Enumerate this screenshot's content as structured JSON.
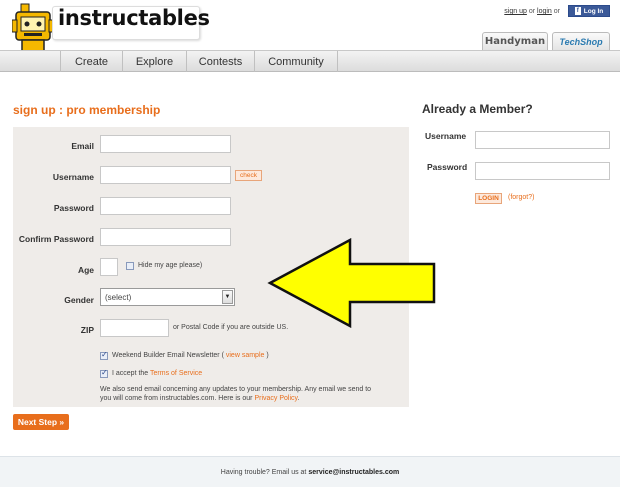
{
  "header": {
    "logo_text": "instructables",
    "signup_link": "sign up",
    "or_1": "or",
    "login_link": "login",
    "or_2": "or",
    "fb_label": "Log In",
    "fb_icon": "f",
    "partner_1": "Handyman",
    "partner_2": "TechShop"
  },
  "nav": {
    "items": [
      "Create",
      "Explore",
      "Contests",
      "Community"
    ]
  },
  "signup": {
    "title": "sign up : pro membership",
    "email_label": "Email",
    "username_label": "Username",
    "check_label": "check",
    "password_label": "Password",
    "confirm_label": "Confirm Password",
    "age_label": "Age",
    "hide_age_text": "Hide my age please)",
    "gender_label": "Gender",
    "gender_value": "(select)",
    "zip_label": "ZIP",
    "zip_hint": "or Postal Code if you are outside US.",
    "newsletter_text": "Weekend Builder Email Newsletter (",
    "newsletter_link": "view sample",
    "newsletter_close": ")",
    "terms_text": "I accept the",
    "terms_link": "Terms of Service",
    "notice_line1": "We also send email concerning any updates to your membership. Any email we send to",
    "notice_line2": "you will come from instructables.com. Here is our",
    "privacy_link": "Privacy Policy",
    "next_button": "Next Step »"
  },
  "member": {
    "title": "Already a Member?",
    "username_label": "Username",
    "password_label": "Password",
    "login_button": "LOGIN",
    "forgot_link": "(forgot?)"
  },
  "footer": {
    "text": "Having trouble? Email us at",
    "email": "service@instructables.com"
  },
  "colors": {
    "accent": "#e86e1c",
    "panel": "#efece9",
    "arrow_fill": "#ffff00"
  }
}
